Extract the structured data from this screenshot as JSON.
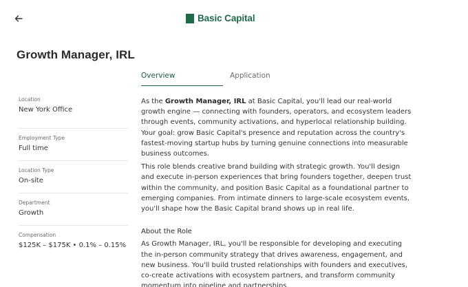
{
  "header": {
    "brand_name": "Basic Capital",
    "brand_color": "#1e6b49"
  },
  "job": {
    "title": "Growth Manager, IRL"
  },
  "tabs": [
    {
      "label": "Overview",
      "active": true
    },
    {
      "label": "Application",
      "active": false
    }
  ],
  "details": [
    {
      "label": "Location",
      "value": "New York Office"
    },
    {
      "label": "Employment Type",
      "value": "Full time"
    },
    {
      "label": "Location Type",
      "value": "On-site"
    },
    {
      "label": "Department",
      "value": "Growth"
    },
    {
      "label": "Compensation",
      "value": "$125K – $175K • 0.1% – 0.15%"
    }
  ],
  "overview": {
    "p1_pre": "As the ",
    "p1_bold": "Growth Manager, IRL",
    "p1_post": " at Basic Capital, you'll lead our real-world growth engine — connecting with founders, operators, and ecosystem leaders through events, community activations, and hyperlocal relationship building. Your goal: grow Basic Capital's presence and reputation across the country's fastest-moving startup hubs by turning genuine connections into measurable business outcomes.",
    "p2": "This role blends creative brand building with strategic growth. You'll design and execute in-person experiences that bring founders together, deepen trust within the community, and position Basic Capital as a foundational partner to emerging companies. From intimate dinners to large-scale ecosystem events, you'll shape how the Basic Capital brand shows up in real life.",
    "about_heading": "About the Role",
    "p3": "As Growth Manager, IRL, you'll be responsible for developing and executing the in-person community strategy that drives awareness, engagement, and new business. You'll build trusted relationships with founders and executives, co-create activations with ecosystem partners, and transform community momentum into pipeline and partnerships."
  }
}
